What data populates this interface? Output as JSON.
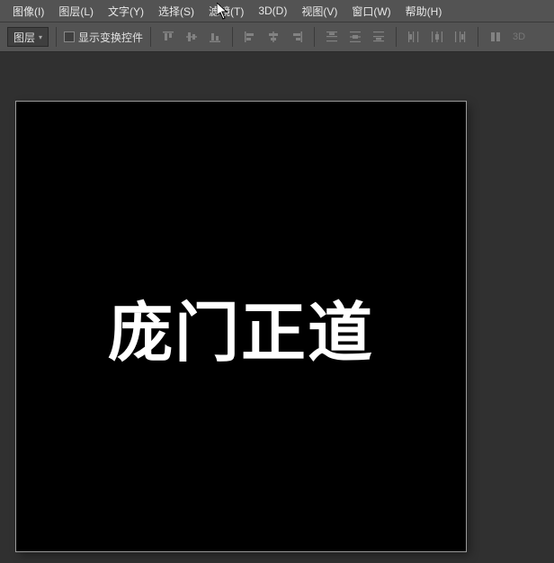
{
  "menu": {
    "image": "图像(I)",
    "layer": "图层(L)",
    "type": "文字(Y)",
    "select": "选择(S)",
    "filter": "滤镜(T)",
    "3d": "3D(D)",
    "view": "视图(V)",
    "window": "窗口(W)",
    "help": "帮助(H)"
  },
  "options": {
    "mode_dropdown": "图层",
    "show_transform_controls": "显示变换控件",
    "badge_3d": "3D"
  },
  "canvas": {
    "text": "庞门正道"
  }
}
